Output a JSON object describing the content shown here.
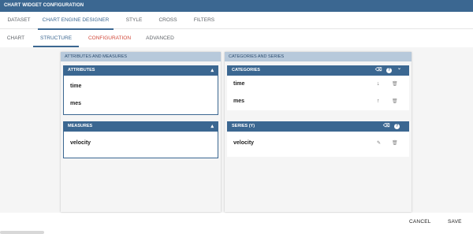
{
  "window": {
    "title": "CHART WIDGET CONFIGURATION"
  },
  "main_tabs": [
    {
      "label": "DATASET"
    },
    {
      "label": "CHART ENGINE DESIGNER"
    },
    {
      "label": "STYLE"
    },
    {
      "label": "CROSS"
    },
    {
      "label": "FILTERS"
    }
  ],
  "sub_tabs": [
    {
      "label": "CHART"
    },
    {
      "label": "STRUCTURE"
    },
    {
      "label": "CONFIGURATION"
    },
    {
      "label": "ADVANCED"
    }
  ],
  "left_panel": {
    "title": "ATTRIBUTES AND MEASURES",
    "attributes": {
      "title": "ATTRIBUTES",
      "items": [
        "time",
        "mes"
      ]
    },
    "measures": {
      "title": "MEASURES",
      "items": [
        "velocity"
      ]
    }
  },
  "right_panel": {
    "title": "CATEGORIES AND SERIES",
    "categories": {
      "title": "CATEGORIES",
      "items": [
        "time",
        "mes"
      ]
    },
    "series": {
      "title": "SERIES (Y)",
      "items": [
        "velocity"
      ]
    }
  },
  "icons": {
    "collapse": "▴",
    "help": "?",
    "eraser": "⌫",
    "down_arrow": "↓",
    "up_arrow": "↑",
    "delete": "🗑",
    "edit": "✎",
    "chevron_down": "⌄"
  },
  "footer": {
    "cancel": "CANCEL",
    "save": "SAVE"
  },
  "colors": {
    "primary": "#3b6791",
    "panel_header": "#b7c9db",
    "warn": "#d14a3b"
  }
}
